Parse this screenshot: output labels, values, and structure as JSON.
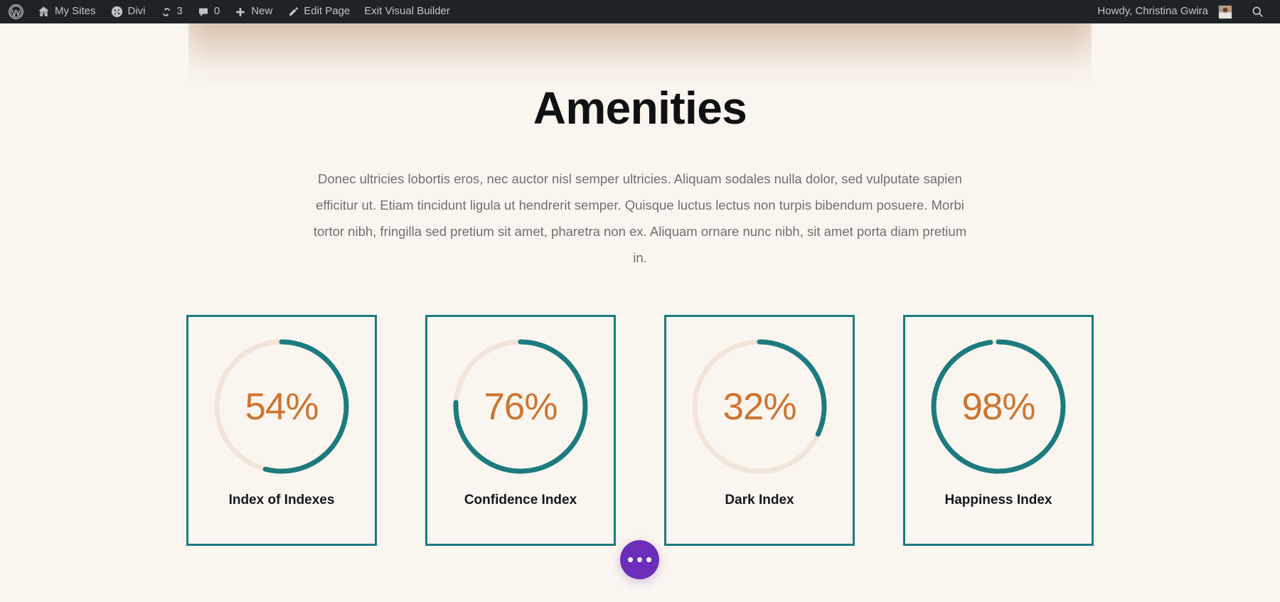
{
  "admin_bar": {
    "items": [
      {
        "id": "wp-logo",
        "icon": "wordpress-icon",
        "label": ""
      },
      {
        "id": "my-sites",
        "icon": "sites-icon",
        "label": "My Sites"
      },
      {
        "id": "divi",
        "icon": "divi-icon",
        "label": "Divi"
      },
      {
        "id": "updates",
        "icon": "updates-icon",
        "label": "3"
      },
      {
        "id": "comments",
        "icon": "comment-icon",
        "label": "0"
      },
      {
        "id": "new-content",
        "icon": "plus-icon",
        "label": "New"
      },
      {
        "id": "edit-page",
        "icon": "pencil-icon",
        "label": "Edit Page"
      },
      {
        "id": "exit-builder",
        "icon": "",
        "label": "Exit Visual Builder"
      }
    ],
    "account": {
      "greeting": "Howdy, Christina Gwira",
      "avatar": "user-avatar",
      "search": "search-icon"
    }
  },
  "section": {
    "title": "Amenities",
    "paragraph": "Donec ultricies lobortis eros, nec auctor nisl semper ultricies. Aliquam sodales nulla dolor, sed vulputate sapien efficitur ut. Etiam tincidunt ligula ut hendrerit semper. Quisque luctus lectus non turpis bibendum posuere. Morbi tortor nibh, fringilla sed pretium sit amet, pharetra non ex. Aliquam ornare nunc nibh, sit amet porta diam pretium in."
  },
  "chart_data": {
    "type": "pie",
    "title": "Amenities",
    "subtitle": "Circle counter modules",
    "legend_position": "none",
    "categories": [
      "Index of Indexes",
      "Confidence Index",
      "Dark Index",
      "Happiness Index"
    ],
    "values": [
      54,
      76,
      32,
      98
    ],
    "value_labels": [
      "54%",
      "76%",
      "32%",
      "98%"
    ],
    "unit": "%",
    "ylim": [
      0,
      100
    ],
    "bar_color": "#1c7b80",
    "track_color": "#f2e4d8",
    "label_color": "#ce7430"
  },
  "counters": [
    {
      "percent": "54%",
      "value": 54,
      "title": "Index of Indexes"
    },
    {
      "percent": "76%",
      "value": 76,
      "title": "Confidence Index"
    },
    {
      "percent": "32%",
      "value": 32,
      "title": "Dark Index"
    },
    {
      "percent": "98%",
      "value": 98,
      "title": "Happiness Index"
    }
  ],
  "fab": {
    "icon": "ellipsis-icon",
    "color": "#6c2eb9"
  },
  "colors": {
    "page_background": "#faf6ef",
    "admin_bar": "#1d2327",
    "teal": "#1c7b80",
    "orange": "#ce7430",
    "track": "#f2e4d8",
    "purple": "#6c2eb9",
    "heading": "#0f1113",
    "body_text": "#6f6f6f"
  }
}
